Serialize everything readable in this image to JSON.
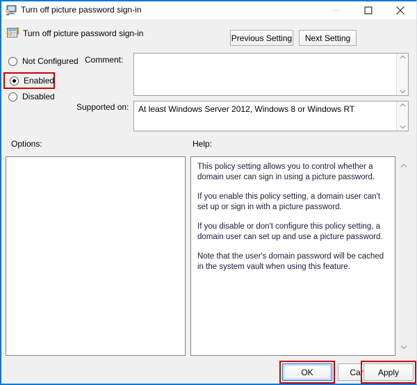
{
  "window": {
    "title": "Turn off picture password sign-in",
    "title_icon": "policy-monitor-icon",
    "controls": {
      "minimize": "minimize-icon",
      "maximize": "maximize-icon",
      "close": "close-icon"
    }
  },
  "header": {
    "icon": "policy-setting-icon",
    "title": "Turn off picture password sign-in",
    "previous_label": "Previous Setting",
    "next_label": "Next Setting"
  },
  "state": {
    "options": [
      {
        "label": "Not Configured",
        "selected": false
      },
      {
        "label": "Enabled",
        "selected": true
      },
      {
        "label": "Disabled",
        "selected": false
      }
    ],
    "selected": "Enabled"
  },
  "fields": {
    "comment_label": "Comment:",
    "comment_value": "",
    "supported_label": "Supported on:",
    "supported_value": "At least Windows Server 2012, Windows 8 or Windows RT"
  },
  "panels": {
    "options_label": "Options:",
    "options_value": "",
    "help_label": "Help:",
    "help_paragraphs": [
      "This policy setting allows you to control whether a domain user can sign in using a picture password.",
      "If you enable this policy setting, a domain user can't set up or sign in with a picture password.",
      "If you disable or don't configure this policy setting, a domain user can set up and use a picture password.",
      "Note that the user's domain password will be cached in the system vault when using this feature."
    ]
  },
  "footer": {
    "ok_label": "OK",
    "cancel_label": "Cancel",
    "apply_label": "Apply"
  },
  "colors": {
    "accent": "#0078d7",
    "highlight": "#cc0000",
    "window_bg": "#f0f0f0",
    "field_bg": "#ffffff"
  }
}
